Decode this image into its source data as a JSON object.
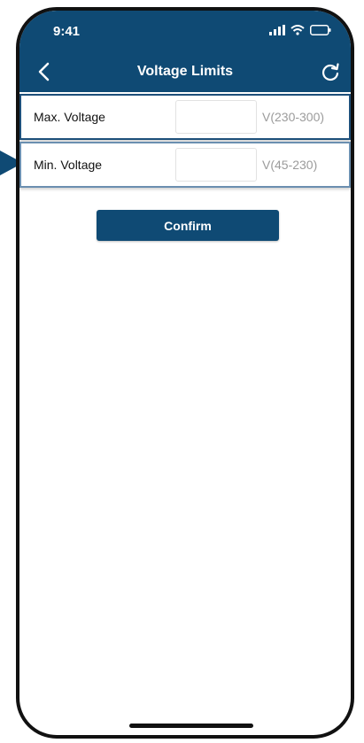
{
  "status_bar": {
    "time": "9:41",
    "icons": [
      "cellular-signal-icon",
      "wifi-icon",
      "battery-icon"
    ]
  },
  "nav": {
    "title": "Voltage Limits",
    "back_icon": "chevron-left-icon",
    "refresh_icon": "refresh-icon"
  },
  "fields": [
    {
      "label": "Max. Voltage",
      "value": "",
      "range": "V(230-300)"
    },
    {
      "label": "Min. Voltage",
      "value": "",
      "range": "V(45-230)"
    }
  ],
  "confirm_label": "Confirm",
  "colors": {
    "header": "#0f4a74",
    "accent": "#1d4f7a",
    "range_text": "#9b9b9b"
  }
}
